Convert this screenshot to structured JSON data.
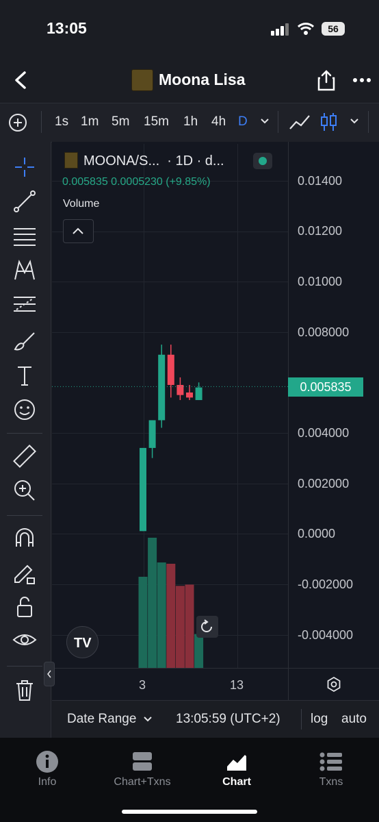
{
  "status_bar": {
    "time": "13:05",
    "battery": "56"
  },
  "header": {
    "title": "Moona Lisa"
  },
  "timeframes": {
    "items": [
      "1s",
      "1m",
      "5m",
      "15m",
      "1h",
      "4h",
      "D"
    ],
    "active": "D"
  },
  "chart": {
    "symbol": "MOONA/S...",
    "interval": "· 1D · d...",
    "ohlc_text": "0.005835  0.0005230 (+9.85%)",
    "volume_label": "Volume",
    "current_price_tag": "0.005835",
    "y_axis_labels": [
      "0.01400",
      "0.01200",
      "0.01000",
      "0.008000",
      "0.004000",
      "0.002000",
      "0.0000",
      "-0.002000",
      "-0.004000"
    ],
    "x_axis_labels": [
      "3",
      "13"
    ],
    "up_color": "#22a78a",
    "down_color": "#f0475a"
  },
  "chart_data": {
    "type": "candlestick",
    "series": [
      {
        "open": 0.0001,
        "high": 0.0034,
        "low": 0.0001,
        "close": 0.0034,
        "volume_dir": "up"
      },
      {
        "open": 0.0034,
        "high": 0.0045,
        "low": 0.003,
        "close": 0.0045,
        "volume_dir": "up"
      },
      {
        "open": 0.0045,
        "high": 0.0075,
        "low": 0.0042,
        "close": 0.0071,
        "volume_dir": "up"
      },
      {
        "open": 0.0071,
        "high": 0.0075,
        "low": 0.0054,
        "close": 0.0059,
        "volume_dir": "down"
      },
      {
        "open": 0.0059,
        "high": 0.0062,
        "low": 0.0053,
        "close": 0.0055,
        "volume_dir": "down"
      },
      {
        "open": 0.0056,
        "high": 0.0059,
        "low": 0.0053,
        "close": 0.0054,
        "volume_dir": "down"
      },
      {
        "open": 0.0053,
        "high": 0.006,
        "low": 0.0053,
        "close": 0.0058,
        "volume_dir": "up"
      }
    ],
    "volumes": [
      0.7,
      1.0,
      0.81,
      0.8,
      0.63,
      0.64,
      0.26
    ],
    "ylim": [
      -0.005,
      0.0145
    ],
    "last_price": 0.005835
  },
  "bottom_bar": {
    "date_range": "Date Range",
    "clock": "13:05:59 (UTC+2)",
    "log": "log",
    "auto": "auto"
  },
  "tabs": [
    {
      "label": "Info"
    },
    {
      "label": "Chart+Txns"
    },
    {
      "label": "Chart"
    },
    {
      "label": "Txns"
    }
  ]
}
